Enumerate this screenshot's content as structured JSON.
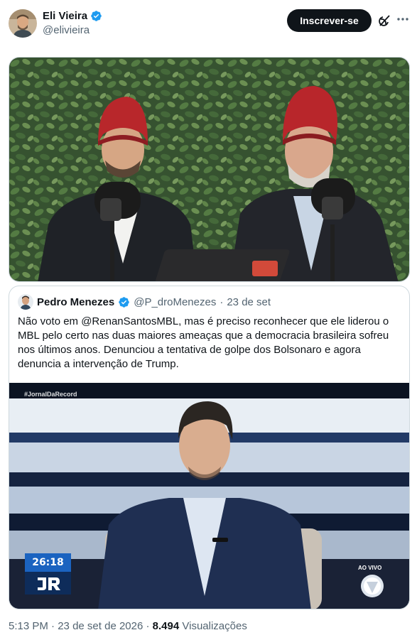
{
  "author": {
    "name": "Eli Vieira",
    "handle": "@elivieira"
  },
  "actions": {
    "subscribe_label": "Inscrever-se"
  },
  "quoted": {
    "name": "Pedro Menezes",
    "handle": "@P_droMenezes",
    "separator": "·",
    "date": "23 de set",
    "text": "Não voto em @RenanSantosMBL, mas é preciso reconhecer que ele liderou o MBL pelo certo nas duas maiores ameaças que a democracia brasileira sofreu nos últimos anos. Denunciou a tentativa de golpe dos Bolsonaro e agora denuncia a intervenção de Trump.",
    "video": {
      "hashtag": "#JornalDaRecord",
      "clock": "26:18",
      "live_label": "AO VIVO"
    }
  },
  "meta": {
    "time": "5:13 PM",
    "separator1": "·",
    "date": "23 de set de 2026",
    "separator2": "·",
    "views_count": "8.494",
    "views_label": "Visualizações"
  },
  "colors": {
    "verified": "#1d9bf0",
    "text_primary": "#0f1419",
    "text_secondary": "#536471",
    "border": "#cfd9de"
  },
  "icons": {
    "verified": "verified-badge-icon",
    "grok": "grok-icon",
    "more": "more-icon"
  }
}
